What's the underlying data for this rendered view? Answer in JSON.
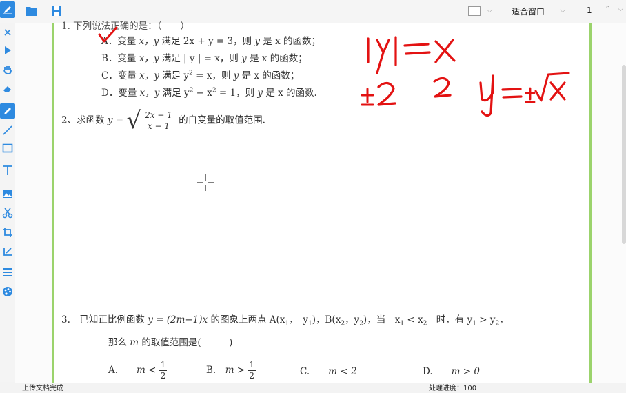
{
  "toolbar": {
    "zoom_label": "适合窗口",
    "page_number": "1",
    "color_swatch": "#ffffff"
  },
  "sidebar": {
    "active_color": "#2e8ae0",
    "items": [
      "close-icon",
      "pointer-icon",
      "hand-icon",
      "eraser-icon",
      "pen-icon",
      "line-icon",
      "rectangle-icon",
      "text-icon",
      "image-icon",
      "scissors-icon",
      "crop-icon",
      "crop-icon",
      "list-icon",
      "palette-icon"
    ]
  },
  "doc": {
    "q1": {
      "top_line": "1. 下列说法正确的是：（　　）",
      "a_prefix": "A．变量",
      "a_vars": "x，y",
      "a_mid": "满足 2x + y = 3，则",
      "a_y": "y",
      "a_end": "是 x 的函数；",
      "b_prefix": "B．变量",
      "b_vars": "x，y",
      "b_mid": "满足 | y | = x，则",
      "b_y": "y",
      "b_end": "是 x 的函数；",
      "c_prefix": "C．变量",
      "c_vars": "x，y",
      "c_mid1": "满足 y",
      "c_exp": "2",
      "c_mid2": "= x，则",
      "c_y": "y",
      "c_end": "是 x 的函数；",
      "d_prefix": "D．变量",
      "d_vars": "x，y",
      "d_mid1": "满足 y",
      "d_exp1": "2",
      "d_mid2": "− x",
      "d_exp2": "2",
      "d_mid3": "= 1，则",
      "d_y": "y",
      "d_end": "是 x 的函数."
    },
    "q2": {
      "prefix": "2、求函数",
      "lhs": "y =",
      "num": "2x − 1",
      "den": "x − 1",
      "suffix": "的自变量的取值范围."
    },
    "q3": {
      "line1a": "3.　已知正比例函数",
      "func": "y = (2m−1)x",
      "line1b": "的图象上两点 A(x",
      "s1": "1",
      "line1c": "，　y",
      "s2": "1",
      "line1d": ")，B(x",
      "s3": "2",
      "line1e": "，y",
      "s4": "2",
      "line1f": ")，当　x",
      "s5": "1",
      "line1g": "< x",
      "s6": "2",
      "line1h": "　时，有 y",
      "s7": "1",
      "line1i": "> y",
      "s8": "2",
      "line1j": "，",
      "line2a": "那么",
      "line2m": "m",
      "line2b": "的取值范围是(　　　)",
      "optA_label": "A.",
      "optA_text": "m <",
      "optA_num": "1",
      "optA_den": "2",
      "optB_label": "B.",
      "optB_text": "m >",
      "optB_num": "1",
      "optB_den": "2",
      "optC_label": "C.",
      "optC_text": "m < 2",
      "optD_label": "D.",
      "optD_text": "m > 0"
    }
  },
  "annotations": {
    "ink_color": "#e31212",
    "ink1": "|y| = x",
    "ink2": "±2　2",
    "ink3": "y = ±√x"
  },
  "status": {
    "left": "上传文档完成",
    "right": "处理进度：100"
  }
}
